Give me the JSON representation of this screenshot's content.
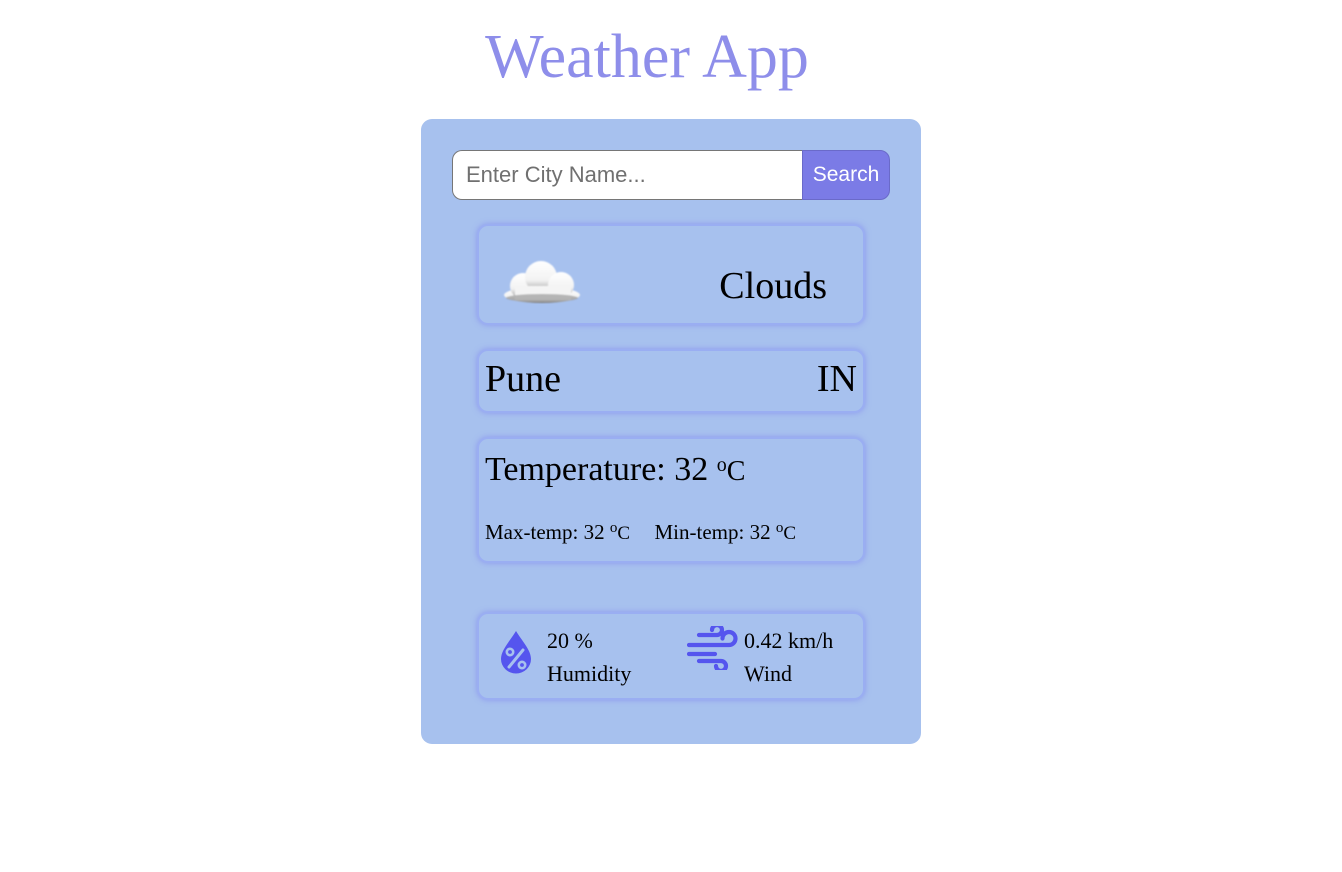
{
  "header": {
    "title": "Weather App",
    "title_color": "#8e8eea"
  },
  "search": {
    "placeholder": "Enter City Name...",
    "value": "",
    "button_label": "Search",
    "button_color": "#7b7be6"
  },
  "weather": {
    "condition": "Clouds",
    "condition_icon": "cloud-icon",
    "city": "Pune",
    "country": "IN",
    "temperature_label": "Temperature:",
    "temperature_value": "32",
    "max_temp_label": "Max-temp:",
    "max_temp_value": "32",
    "min_temp_label": "Min-temp:",
    "min_temp_value": "32",
    "unit_o": "o",
    "unit_c": "C"
  },
  "details": {
    "humidity_value": "20 %",
    "humidity_label": "Humidity",
    "humidity_icon": "humidity-percent-icon",
    "wind_value": "0.42 km/h",
    "wind_label": "Wind",
    "wind_icon": "wind-icon",
    "icon_color": "#5555ee"
  },
  "theme": {
    "card_background": "#a7c1ee",
    "page_background": "#ffffff"
  }
}
